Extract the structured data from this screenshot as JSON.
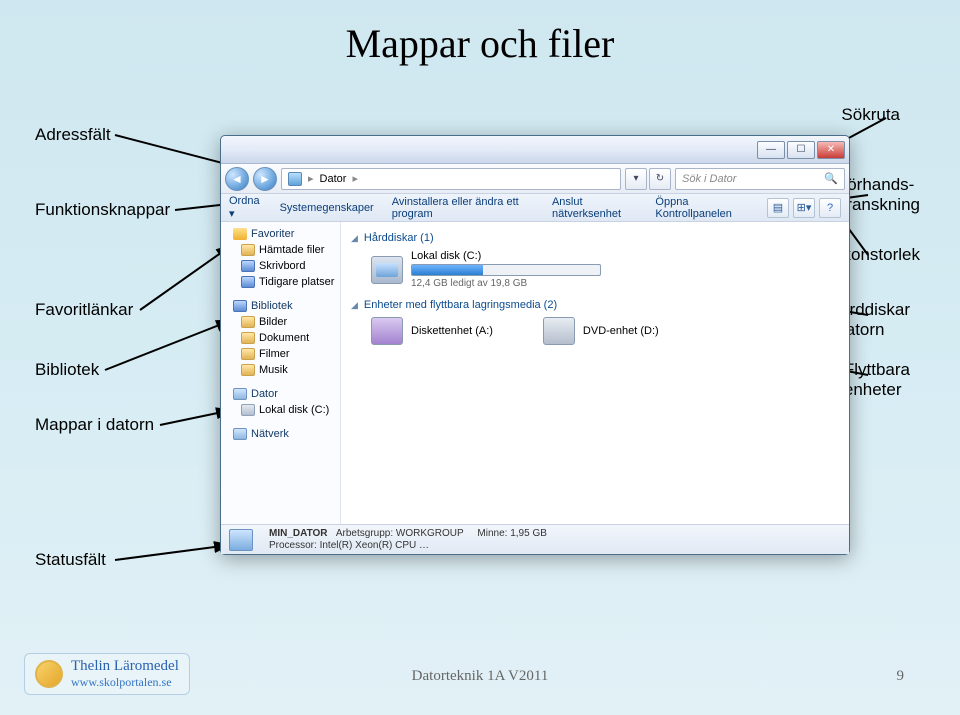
{
  "slide": {
    "title": "Mappar och filer"
  },
  "labels": {
    "adressfalt": "Adressfält",
    "funktionsknappar": "Funktionsknappar",
    "favoritlankar": "Favoritlänkar",
    "bibliotek": "Bibliotek",
    "mappar_i_datorn": "Mappar i datorn",
    "statusfalt": "Statusfält",
    "sokruta": "Sökruta",
    "forhandsgranskning": "Förhands-\ngranskning",
    "ikonstorlek": "Ikonstorlek",
    "harddiskar": "Hårddiskar\ni datorn",
    "flyttbara": "Flyttbara\nenheter"
  },
  "window": {
    "breadcrumb": {
      "root": "Dator",
      "sep1": "▸",
      "sep2": "▸"
    },
    "search_placeholder": "Sök i Dator",
    "toolbar": {
      "ordna": "Ordna ▾",
      "system": "Systemegenskaper",
      "avinstallera": "Avinstallera eller ändra ett program",
      "anslut": "Anslut nätverksenhet",
      "kontrollpanel": "Öppna Kontrollpanelen"
    },
    "sidebar": {
      "favoriter": "Favoriter",
      "hamtade": "Hämtade filer",
      "skrivbord": "Skrivbord",
      "tidigare": "Tidigare platser",
      "bibliotek": "Bibliotek",
      "bilder": "Bilder",
      "dokument": "Dokument",
      "filmer": "Filmer",
      "musik": "Musik",
      "dator": "Dator",
      "lokal": "Lokal disk (C:)",
      "natverk": "Nätverk"
    },
    "content": {
      "group1": "Hårddiskar (1)",
      "disk_name": "Lokal disk (C:)",
      "disk_free": "12,4 GB ledigt av 19,8 GB",
      "group2": "Enheter med flyttbara lagringsmedia (2)",
      "floppy": "Diskettenhet (A:)",
      "dvd": "DVD-enhet (D:)"
    },
    "status": {
      "line1a": "MIN_DATOR",
      "line1b": "Arbetsgrupp: WORKGROUP",
      "line1c": "Minne: 1,95 GB",
      "line2": "Processor: Intel(R) Xeon(R) CPU  …"
    }
  },
  "footer": {
    "logo1": "Thelin Läromedel",
    "logo2": "www.skolportalen.se",
    "center": "Datorteknik 1A V2011",
    "page": "9"
  }
}
